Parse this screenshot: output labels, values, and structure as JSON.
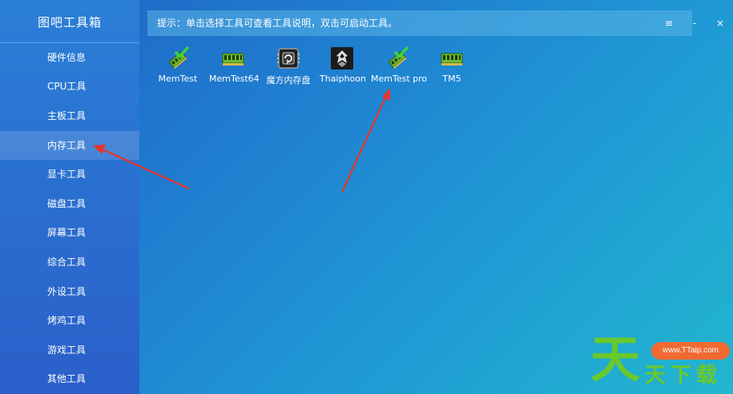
{
  "app": {
    "title": "图吧工具箱"
  },
  "sidebar": {
    "items": [
      {
        "label": "硬件信息"
      },
      {
        "label": "CPU工具"
      },
      {
        "label": "主板工具"
      },
      {
        "label": "内存工具",
        "active": true
      },
      {
        "label": "显卡工具"
      },
      {
        "label": "磁盘工具"
      },
      {
        "label": "屏幕工具"
      },
      {
        "label": "综合工具"
      },
      {
        "label": "外设工具"
      },
      {
        "label": "烤鸡工具"
      },
      {
        "label": "游戏工具"
      },
      {
        "label": "其他工具"
      }
    ]
  },
  "header": {
    "hint": "提示：单击选择工具可查看工具说明，双击可启动工具。",
    "menu_glyph": "≡",
    "minimize_glyph": "-",
    "close_glyph": "×"
  },
  "tools": [
    {
      "label": "MemTest",
      "icon": "memtest-icon"
    },
    {
      "label": "MemTest64",
      "icon": "ram-module-icon"
    },
    {
      "label": "魔方内存盘",
      "icon": "ramdisk-chip-icon"
    },
    {
      "label": "Thaiphoon",
      "icon": "thaiphoon-icon"
    },
    {
      "label": "MemTest pro",
      "icon": "memtest-icon"
    },
    {
      "label": "TM5",
      "icon": "ram-module-icon"
    }
  ],
  "watermark": {
    "badge": "www.TTaip.com",
    "big_char": "天",
    "small_text": "天下载"
  },
  "colors": {
    "arrow": "#e8342a",
    "ram_green": "#6dbb2f",
    "check_green": "#3fd13f",
    "watermark_green": "#6ac92a",
    "watermark_orange": "#f06a32"
  }
}
